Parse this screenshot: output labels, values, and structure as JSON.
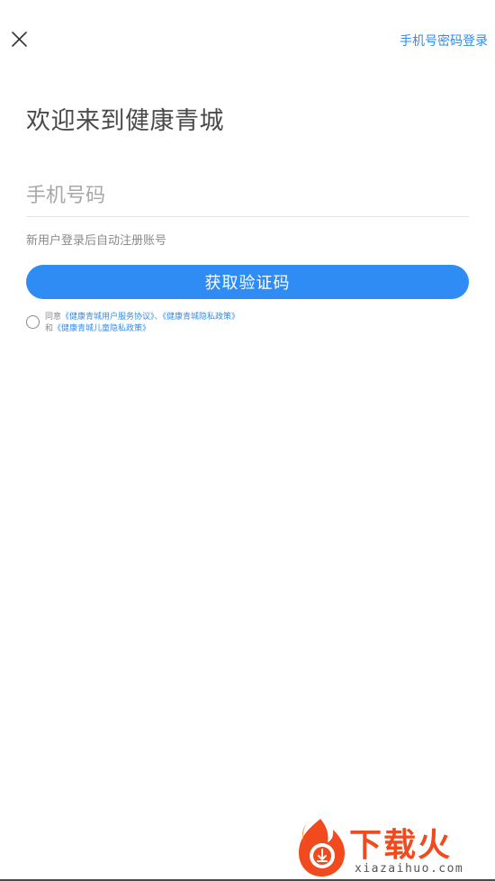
{
  "header": {
    "close_icon": "close-icon",
    "password_login_label": "手机号密码登录"
  },
  "welcome": {
    "title": "欢迎来到健康青城"
  },
  "phone": {
    "placeholder": "手机号码",
    "value": ""
  },
  "hint": {
    "text": "新用户登录后自动注册账号"
  },
  "get_code_button": {
    "label": "获取验证码"
  },
  "agreement": {
    "prefix": "同意",
    "service_link": "《健康青城用户服务协议》",
    "separator": "、",
    "privacy_link": "《健康青城隐私政策》",
    "conjunction": "和",
    "child_privacy_link": "《健康青城儿童隐私政策》",
    "checked": false
  },
  "watermark": {
    "title": "下载火",
    "url": "xiazaihuo.com"
  },
  "colors": {
    "accent": "#2f8cf5",
    "link": "#2f8cf0",
    "watermark": "#f04a1e"
  }
}
